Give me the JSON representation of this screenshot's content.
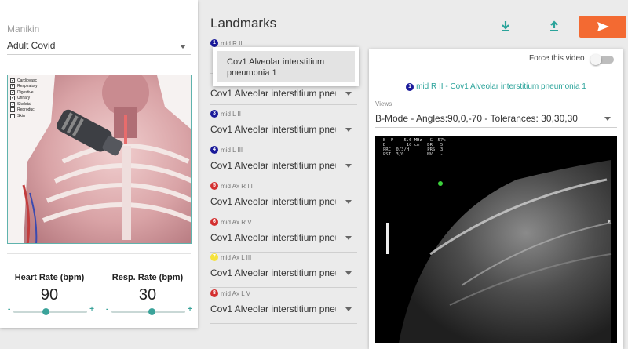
{
  "manikin": {
    "label": "Manikin",
    "selected": "Adult Covid"
  },
  "anatomy_layers": [
    {
      "label": "Cardiovasc",
      "checked": true
    },
    {
      "label": "Respiratory",
      "checked": true
    },
    {
      "label": "Digestive",
      "checked": true
    },
    {
      "label": "Urinary",
      "checked": true
    },
    {
      "label": "Skeletal",
      "checked": true
    },
    {
      "label": "Reproduc",
      "checked": false
    },
    {
      "label": "Skin",
      "checked": false
    }
  ],
  "vitals": {
    "heart_rate": {
      "label": "Heart Rate (bpm)",
      "value": "90",
      "minus": "-",
      "plus": "+",
      "level": 0.45
    },
    "resp_rate": {
      "label": "Resp. Rate (bpm)",
      "value": "30",
      "minus": "-",
      "plus": "+",
      "level": 0.55
    }
  },
  "landmarks": {
    "title": "Landmarks",
    "items": [
      {
        "num": "1",
        "name": "mid R II",
        "value": "Cov1 Alveolar interstitium pneu...",
        "color": "#1a1a9a"
      },
      {
        "num": "3",
        "name": "mid L II",
        "value": "Cov1 Alveolar interstitium pneu...",
        "color": "#1a1a9a"
      },
      {
        "num": "4",
        "name": "mid L III",
        "value": "Cov1 Alveolar interstitium pneu...",
        "color": "#1a1a9a"
      },
      {
        "num": "5",
        "name": "mid Ax R III",
        "value": "Cov1 Alveolar interstitium pneu...",
        "color": "#d32f2f"
      },
      {
        "num": "6",
        "name": "mid Ax R V",
        "value": "Cov1 Alveolar interstitium pneu...",
        "color": "#d32f2f"
      },
      {
        "num": "7",
        "name": "mid Ax L III",
        "value": "Cov1 Alveolar interstitium pneu...",
        "color": "#f5e23a"
      },
      {
        "num": "8",
        "name": "mid Ax L V",
        "value": "Cov1 Alveolar interstitium pneu...",
        "color": "#d32f2f"
      }
    ],
    "second_item_value": "Cov1 Alveolar interstitium pneu...",
    "dropdown_option": "Cov1 Alveolar interstitium pneumonia 1"
  },
  "toolbar": {
    "download_icon": "download-icon",
    "upload_icon": "upload-icon",
    "send_icon": "send-icon",
    "accent": "#2aa39a",
    "send_color": "#f36a32"
  },
  "video_panel": {
    "force_label": "Force this video",
    "force_on": false,
    "badge": "1",
    "title": "mid R II - Cov1 Alveolar interstitium pneumonia 1",
    "views_label": "Views",
    "view_selected": "B-Mode - Angles:90,0,-70 - Tolerances: 30,30,30",
    "us_info": "B  F    5.6 MHz   G  57%\nD        10 cm   DR   5\nPRC  0/3/H       PRS  3\nPST  3/0         MV   -"
  }
}
